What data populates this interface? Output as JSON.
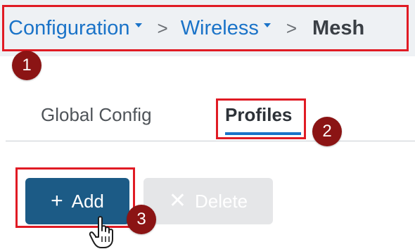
{
  "breadcrumb": {
    "items": [
      {
        "label": "Configuration"
      },
      {
        "label": "Wireless"
      }
    ],
    "separator": ">",
    "current": "Mesh"
  },
  "tabs": [
    {
      "label": "Global Config",
      "active": false
    },
    {
      "label": "Profiles",
      "active": true
    }
  ],
  "toolbar": {
    "add_label": "Add",
    "add_icon": "plus-icon",
    "delete_label": "Delete",
    "delete_icon": "close-icon",
    "delete_enabled": false
  },
  "annotations": {
    "step_1": "1",
    "step_2": "2",
    "step_3": "3"
  },
  "colors": {
    "link": "#1a73c8",
    "primary_button": "#1c5b86",
    "disabled_button": "#e5e6e8",
    "highlight": "#e01b24",
    "badge": "#8b1414"
  }
}
